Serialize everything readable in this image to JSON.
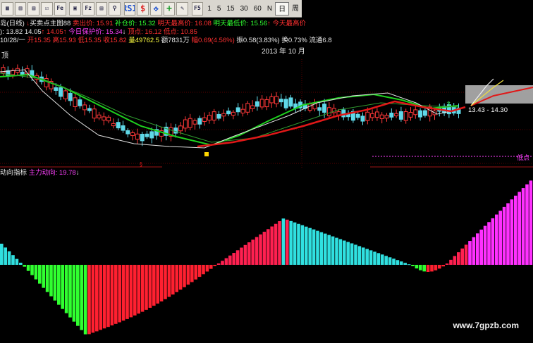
{
  "toolbar": {
    "icons": [
      "chart-icon",
      "bars-icon",
      "grid-icon",
      "checked-icon",
      "fe-icon",
      "table-icon",
      "fz-icon",
      "document-icon",
      "search-icon",
      "rsi-icon",
      "money-icon",
      "move-icon",
      "plus-icon",
      "pen-icon",
      "f5-icon"
    ],
    "periods": [
      "1",
      "5",
      "15",
      "30",
      "60",
      "N",
      "日",
      "周"
    ],
    "active_period": "日"
  },
  "header": {
    "line1": {
      "stock": "岛(日线)",
      "indicator": "买卖点主图88",
      "sell_price": "卖出价: 15.91",
      "add_price": "补仓价: 15.32",
      "tomorrow_high": "明天最高价: 16.08",
      "tomorrow_low": "明天最低价: 15.56",
      "today_high": "今天最高价"
    },
    "line2": {
      "val1": "): 13.82",
      "val2": "14.05",
      "val3": "14.05",
      "protect": "今日保护价: 15.34",
      "top": "顶点: 16.12",
      "low": "低点: 10.85"
    },
    "line3": {
      "date": "10/28/一",
      "open": "开15.35",
      "high": "高15.93",
      "low": "低15.35",
      "close": "收15.82",
      "volume": "量49762.5",
      "amount": "额7831万",
      "change": "幅0.69(4.56%)",
      "amplitude": "振0.58(3.83%)",
      "turnover": "换0.73%",
      "float": "流通6.8"
    },
    "date_label": "2013 年 10 月"
  },
  "main_chart_labels": {
    "top_left": "顶",
    "price_range": "13.43 - 14.30",
    "low_point": "低点"
  },
  "indicator": {
    "name": "动向指标",
    "line": "主力动向: 19.78"
  },
  "watermark": "www.7gpzb.com"
}
